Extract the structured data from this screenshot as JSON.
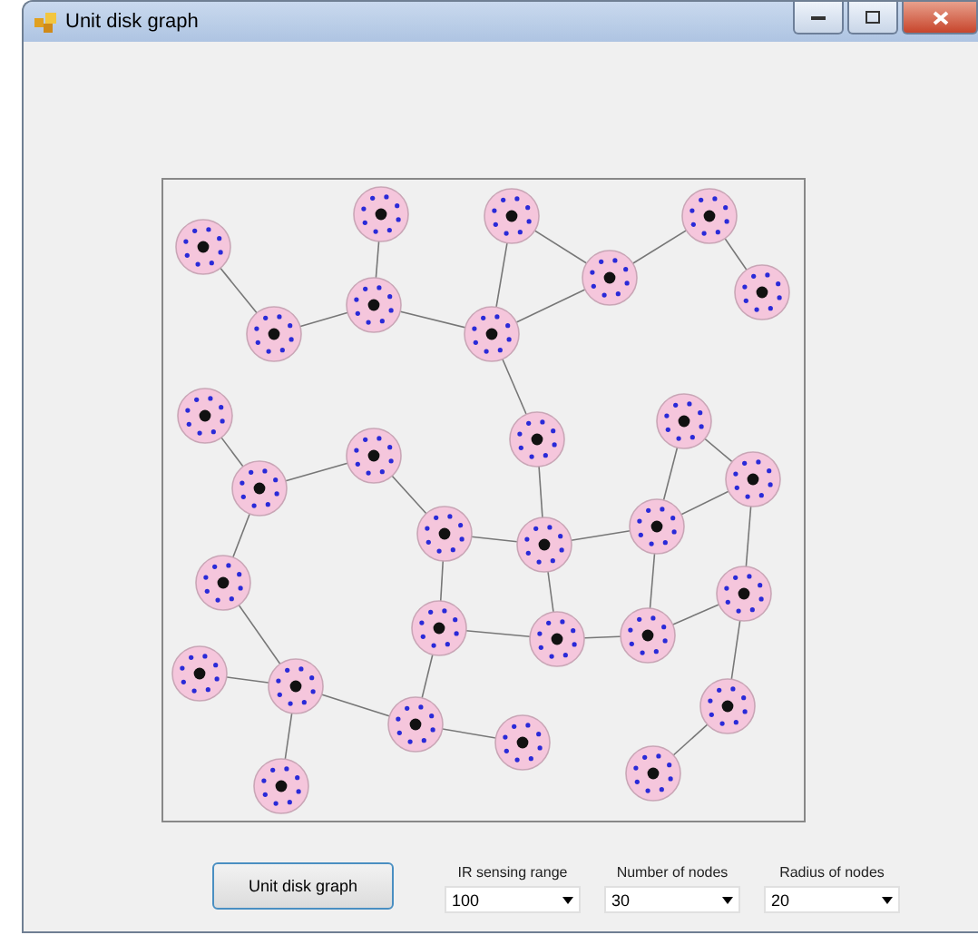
{
  "window": {
    "title": "Unit disk graph"
  },
  "button": {
    "label": "Unit disk graph"
  },
  "settings": [
    {
      "label": "IR sensing range",
      "value": "100"
    },
    {
      "label": "Number of nodes",
      "value": "30"
    },
    {
      "label": "Radius of nodes",
      "value": "20"
    }
  ]
}
